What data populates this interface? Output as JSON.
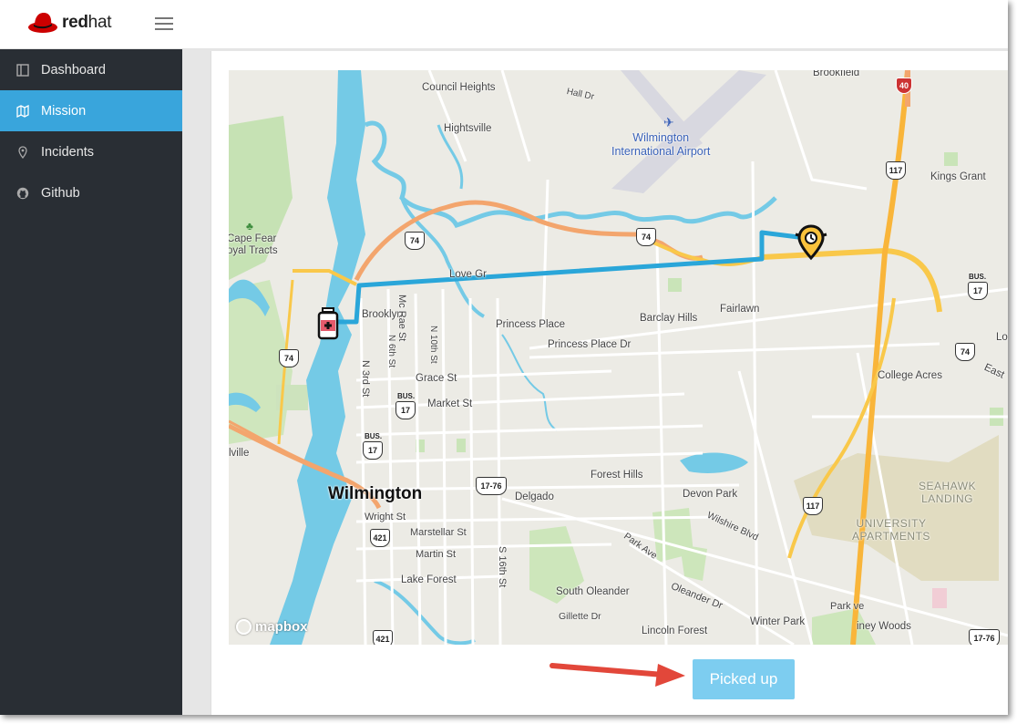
{
  "header": {
    "logo_bold": "red",
    "logo_thin": "hat"
  },
  "sidebar": {
    "items": [
      {
        "label": "Dashboard",
        "icon": "dashboard-icon",
        "active": false
      },
      {
        "label": "Mission",
        "icon": "map-icon",
        "active": true
      },
      {
        "label": "Incidents",
        "icon": "location-pin-icon",
        "active": false
      },
      {
        "label": "Github",
        "icon": "github-icon",
        "active": false
      }
    ]
  },
  "map": {
    "attribution": "mapbox",
    "labels": {
      "brookfield": "Brookfield",
      "council_heights": "Council Heights",
      "hall_dr": "Hall Dr",
      "hightsville": "Hightsville",
      "airport": "Wilmington\nInternational Airport",
      "kings_grant": "Kings Grant",
      "cape_fear": "Cape Fear\noyal Tracts",
      "love_grove": "Love Gr",
      "brooklyn": "Brooklyn",
      "mc_rae": "Mc Rae St",
      "n6th": "N 6th St",
      "n10th": "N 10th St",
      "n3rd": "N 3rd St",
      "princess_place": "Princess Place",
      "princess_place_dr": "Princess Place Dr",
      "barclay_hills": "Barclay Hills",
      "fairlawn": "Fairlawn",
      "grace_st": "Grace St",
      "market_st": "Market St",
      "college_acres": "College Acres",
      "east": "East",
      "lo": "Lo",
      "villle": "lville",
      "forest_hills": "Forest Hills",
      "wilmington": "Wilmington",
      "delgado": "Delgado",
      "devon_park": "Devon Park",
      "wilshire": "Wilshire Blvd",
      "wright_st": "Wright St",
      "marstellar": "Marstellar St",
      "martin_st": "Martin St",
      "s16th": "S 16th St",
      "park_ave": "Park Ave",
      "seahawk": "SEAHAWK\nLANDING",
      "univ_apts": "UNIVERSITY\nAPARTMENTS",
      "lake_forest": "Lake Forest",
      "south_oleander": "South Oleander",
      "oleander_dr": "Oleander Dr",
      "gillette": "Gillette Dr",
      "lincoln_forest": "Lincoln Forest",
      "winter_park": "Winter Park",
      "park_ave2": "Park ve",
      "piney_woods": "iney Woods"
    },
    "shields": {
      "i40": "40",
      "us117_a": "117",
      "us74_a": "74",
      "us74_b": "74",
      "us74_c": "74",
      "us74_d": "74",
      "bus17_a": "17",
      "bus17_b": "17",
      "bus17_c": "17",
      "us17_76_a": "17-76",
      "us17_76_b": "17-76",
      "us421_a": "421",
      "us421_b": "421",
      "us117_b": "117",
      "bus_tag": "BUS."
    }
  },
  "actions": {
    "picked_up_label": "Picked up"
  },
  "colors": {
    "accent": "#39a5dc",
    "route": "#2aa6d9",
    "button": "#7dcdf0",
    "sidebar_bg": "#292e34",
    "annotation_arrow": "#e2473a"
  }
}
